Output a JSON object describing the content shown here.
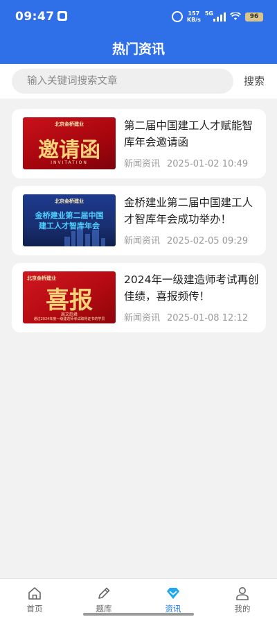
{
  "status_bar": {
    "time": "09:47",
    "speed_value": "157",
    "speed_unit": "KB/s",
    "network": "5G",
    "battery": "96"
  },
  "header": {
    "title": "热门资讯"
  },
  "search": {
    "placeholder": "输入关键词搜索文章",
    "button_label": "搜索"
  },
  "articles": [
    {
      "title": "第二届中国建工人才赋能智库年会邀请函",
      "category": "新闻资讯",
      "date": "2025-01-02 10:49",
      "thumb_brand": "北京金桥建业",
      "thumb_headline": "邀请函",
      "thumb_sub": "INVITATION"
    },
    {
      "title": "金桥建业第二届中国建工人才智库年会成功举办！",
      "category": "新闻资讯",
      "date": "2025-02-05 09:29",
      "thumb_brand": "北京金桥建业",
      "thumb_headline_1": "金桥建业第二届中国",
      "thumb_headline_2": "建工人才智库年会"
    },
    {
      "title": "2024年一级建造师考试再创佳绩，喜报频传！",
      "category": "新闻资讯",
      "date": "2025-01-08 12:12",
      "thumb_brand": "北京金桥建业",
      "thumb_headline": "喜报",
      "thumb_sub": "高文彪君",
      "thumb_sub2": "通过2024年度一级建造师考试取得证书的学员"
    }
  ],
  "tabbar": {
    "tabs": [
      {
        "label": "首页",
        "icon": "home-icon"
      },
      {
        "label": "题库",
        "icon": "pencil-icon"
      },
      {
        "label": "资讯",
        "icon": "diamond-icon"
      },
      {
        "label": "我的",
        "icon": "user-icon"
      }
    ],
    "active": "资讯"
  },
  "colors": {
    "primary": "#2f6fe8",
    "tab_active": "#1677ff",
    "background": "#f2f2f2"
  }
}
